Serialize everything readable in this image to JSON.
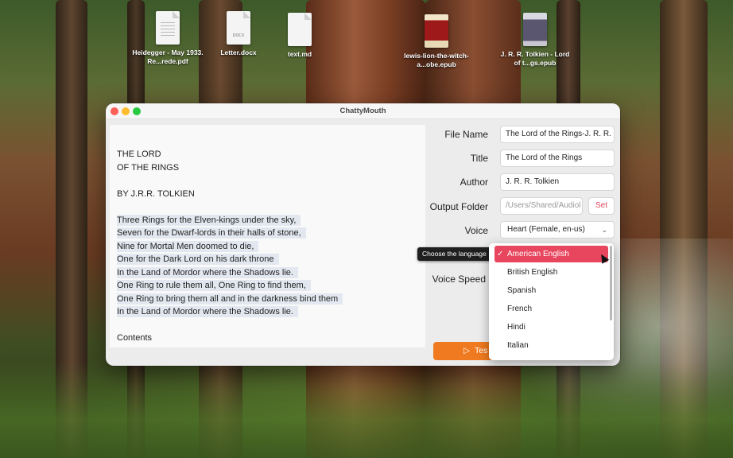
{
  "desktop": {
    "icons": [
      {
        "label": "Heidegger - May 1933. Re...rede.pdf",
        "kind": "document"
      },
      {
        "label": "Letter.docx",
        "kind": "docx",
        "tag": "DOCX"
      },
      {
        "label": "text.md",
        "kind": "blank"
      },
      {
        "label": "lewis-lion-the-witch-a...obe.epub",
        "kind": "book-red"
      },
      {
        "label": "J. R. R. Tolkien - Lord of t...gs.epub",
        "kind": "book-gray"
      }
    ]
  },
  "window": {
    "title": "ChattyMouth",
    "text_lines": [
      {
        "text": "THE LORD",
        "sel": false
      },
      {
        "text": "OF THE RINGS",
        "sel": false
      },
      {
        "text": "",
        "sel": false
      },
      {
        "text": "BY J.R.R. TOLKIEN",
        "sel": false
      },
      {
        "text": "",
        "sel": false
      },
      {
        "text": "Three Rings for the Elven-kings under the sky,",
        "sel": true
      },
      {
        "text": "Seven for the Dwarf-lords in their halls of stone,",
        "sel": true
      },
      {
        "text": "Nine for Mortal Men doomed to die,",
        "sel": true
      },
      {
        "text": "One for the Dark Lord on his dark throne",
        "sel": true
      },
      {
        "text": "In the Land of Mordor where the Shadows lie.",
        "sel": true
      },
      {
        "text": "One Ring to rule them all, One Ring to find them,",
        "sel": true
      },
      {
        "text": "One Ring to bring them all and in the darkness bind them",
        "sel": true
      },
      {
        "text": "In the Land of Mordor where the Shadows lie.",
        "sel": true
      },
      {
        "text": "",
        "sel": false
      },
      {
        "text": "Contents",
        "sel": false
      }
    ],
    "form": {
      "file_name_label": "File Name",
      "file_name_value": "The Lord of the Rings-J. R. R.",
      "title_label": "Title",
      "title_value": "The Lord of the Rings",
      "author_label": "Author",
      "author_value": "J. R. R. Tolkien",
      "output_label": "Output Folder",
      "output_value": "/Users/Shared/Audiol",
      "set_label": "Set",
      "voice_label": "Voice",
      "voice_value": "Heart (Female, en-us)",
      "voice_speed_label": "Voice Speed",
      "test_label": "Tes"
    }
  },
  "tooltip": "Choose the language",
  "language_menu": {
    "options": [
      "American English",
      "British English",
      "Spanish",
      "French",
      "Hindi",
      "Italian"
    ],
    "selected_index": 0
  },
  "colors": {
    "accent": "#e8465f",
    "test_button": "#f07a1f",
    "set_text": "#e0455a"
  }
}
